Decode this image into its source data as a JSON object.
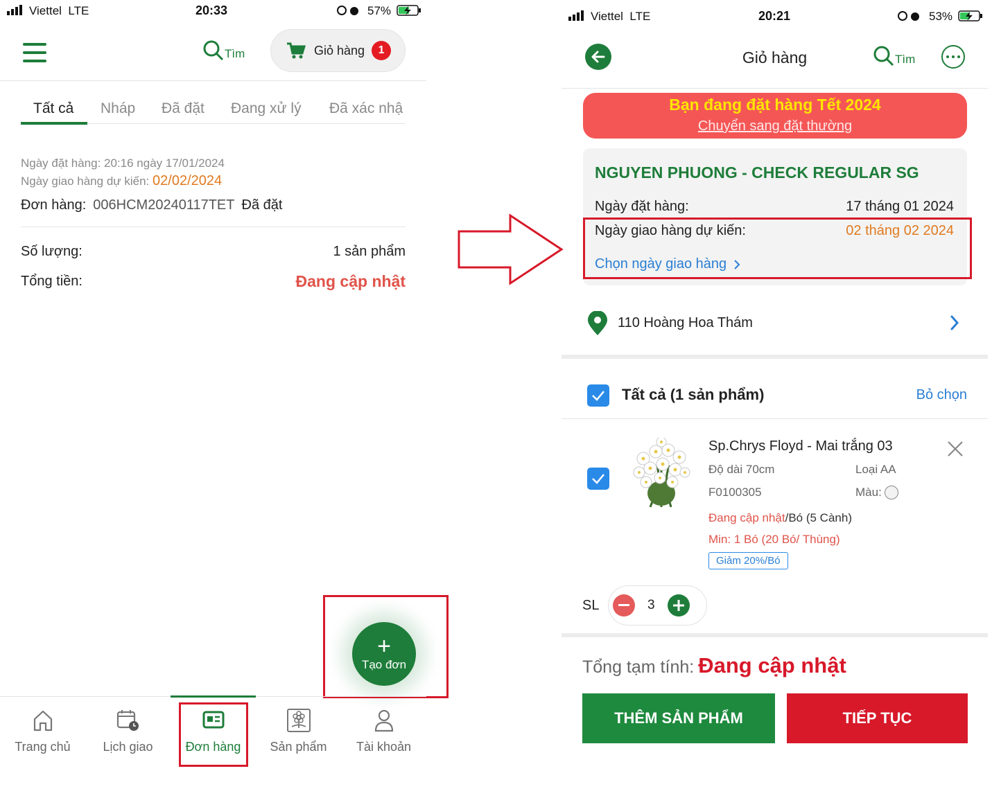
{
  "left": {
    "status": {
      "carrier": "Viettel",
      "network": "LTE",
      "time": "20:33",
      "battery": "57%"
    },
    "header": {
      "search_label": "Tìm",
      "cart_label": "Giỏ hàng",
      "cart_count": "1"
    },
    "tabs": [
      "Tất cả",
      "Nháp",
      "Đã đặt",
      "Đang xử lý",
      "Đã xác nhậ"
    ],
    "order": {
      "order_date_line": "Ngày đặt hàng: 20:16 ngày 17/01/2024",
      "delivery_prefix": "Ngày giao hàng dự kiến: ",
      "delivery_date": "02/02/2024",
      "order_label": "Đơn hàng:",
      "order_code": "006HCM20240117TET",
      "order_status": "Đã đặt",
      "qty_label": "Số lượng:",
      "qty_value": "1 sản phẩm",
      "total_label": "Tổng tiền:",
      "total_value": "Đang cập nhật"
    },
    "fab": {
      "plus": "+",
      "label": "Tạo đơn"
    },
    "nav": [
      "Trang chủ",
      "Lịch giao",
      "Đơn hàng",
      "Sản phẩm",
      "Tài khoản"
    ]
  },
  "right": {
    "status": {
      "carrier": "Viettel",
      "network": "LTE",
      "time": "20:21",
      "battery": "53%"
    },
    "header": {
      "title": "Giỏ hàng",
      "search_label": "Tìm"
    },
    "banner": {
      "title": "Bạn đang đặt hàng Tết 2024",
      "link": "Chuyển sang đặt thường"
    },
    "customer": {
      "name": "NGUYEN PHUONG - CHECK REGULAR SG",
      "order_date_label": "Ngày đặt hàng:",
      "order_date": "17 tháng 01 2024",
      "delivery_label": "Ngày giao hàng dự kiến:",
      "delivery_date": "02 tháng 02 2024",
      "choose_link": "Chọn ngày giao hàng"
    },
    "address": "110 Hoàng Hoa Thám",
    "select_all": {
      "label": "Tất cả (1 sản phẩm)",
      "deselect": "Bỏ chọn"
    },
    "product": {
      "name": "Sp.Chrys Floyd - Mai trắng 03",
      "length": "Độ dài 70cm",
      "grade": "Loại AA",
      "code": "F0100305",
      "color_label": "Màu:",
      "price_status": "Đang cập nhật",
      "unit": "/Bó (5 Cành)",
      "min": "Min: 1 Bó (20 Bó/ Thùng)",
      "discount": "Giảm 20%/Bó",
      "qty_label": "SL",
      "qty": "3"
    },
    "footer": {
      "total_label": "Tổng tạm tính:",
      "total_value": "Đang cập nhật",
      "add_button": "THÊM SẢN PHẨM",
      "continue_button": "TIẾP TỤC"
    }
  },
  "colors": {
    "brand_green": "#1e7d3a",
    "alert_red": "#d7192a",
    "orange": "#e07a20",
    "link_blue": "#2a7fd4"
  }
}
